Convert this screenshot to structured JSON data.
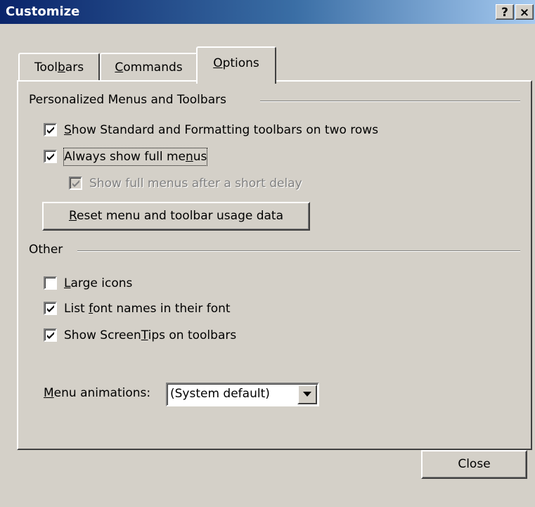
{
  "window": {
    "title": "Customize",
    "help_label": "?",
    "close_label": "×"
  },
  "tabs": [
    {
      "label_pre": "Tool",
      "label_key": "b",
      "label_post": "ars",
      "active": false
    },
    {
      "label_pre": "",
      "label_key": "C",
      "label_post": "ommands",
      "active": false
    },
    {
      "label_pre": "",
      "label_key": "O",
      "label_post": "ptions",
      "active": true
    }
  ],
  "personalized": {
    "group_label": "Personalized Menus and Toolbars",
    "two_rows": {
      "pre": "",
      "key": "S",
      "post": "how Standard and Formatting toolbars on two rows",
      "checked": true
    },
    "full_menus": {
      "pre": "Always show full me",
      "key": "n",
      "post": "us",
      "checked": true
    },
    "delay": {
      "label": "Show full menus after a short delay",
      "checked": true,
      "disabled": true
    },
    "reset_button": {
      "pre": "",
      "key": "R",
      "post": "eset menu and toolbar usage data"
    }
  },
  "other": {
    "group_label": "Other",
    "large_icons": {
      "pre": "",
      "key": "L",
      "post": "arge icons",
      "checked": false
    },
    "font_names": {
      "pre": "List ",
      "key": "f",
      "post": "ont names in their font",
      "checked": true
    },
    "screentips": {
      "pre": "Show Screen",
      "key": "T",
      "post": "ips on toolbars",
      "checked": true
    }
  },
  "menu_animations": {
    "label_pre": "",
    "label_key": "M",
    "label_post": "enu animations:",
    "selected": "(System default)"
  },
  "footer": {
    "close_button": "Close"
  },
  "icons": {
    "check": "check-icon",
    "dropdown": "chevron-down-icon"
  }
}
